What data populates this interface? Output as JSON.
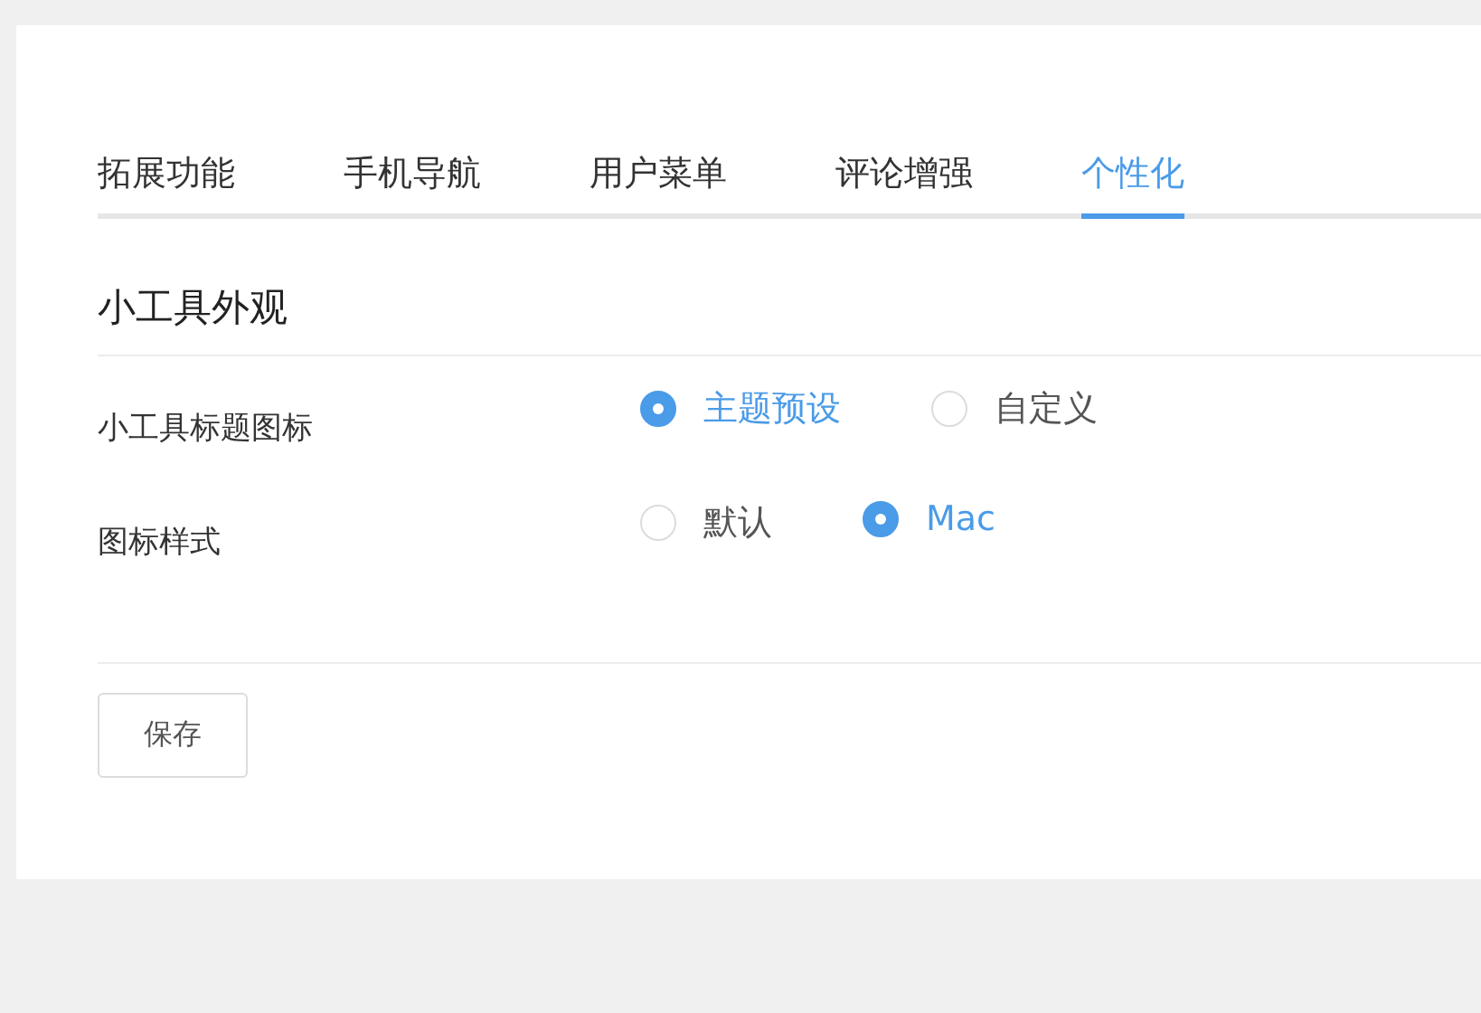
{
  "tabs": [
    {
      "label": "拓展功能",
      "selected": false
    },
    {
      "label": "手机导航",
      "selected": false
    },
    {
      "label": "用户菜单",
      "selected": false
    },
    {
      "label": "评论增强",
      "selected": false
    },
    {
      "label": "个性化",
      "selected": true
    }
  ],
  "section": {
    "title": "小工具外观"
  },
  "options": [
    {
      "label": "小工具标题图标",
      "choices": [
        {
          "label": "主题预设",
          "selected": true
        },
        {
          "label": "自定义",
          "selected": false
        }
      ]
    },
    {
      "label": "图标样式",
      "choices": [
        {
          "label": "默认",
          "selected": false
        },
        {
          "label": "Mac",
          "selected": true
        }
      ]
    }
  ],
  "buttons": [
    "保存"
  ]
}
